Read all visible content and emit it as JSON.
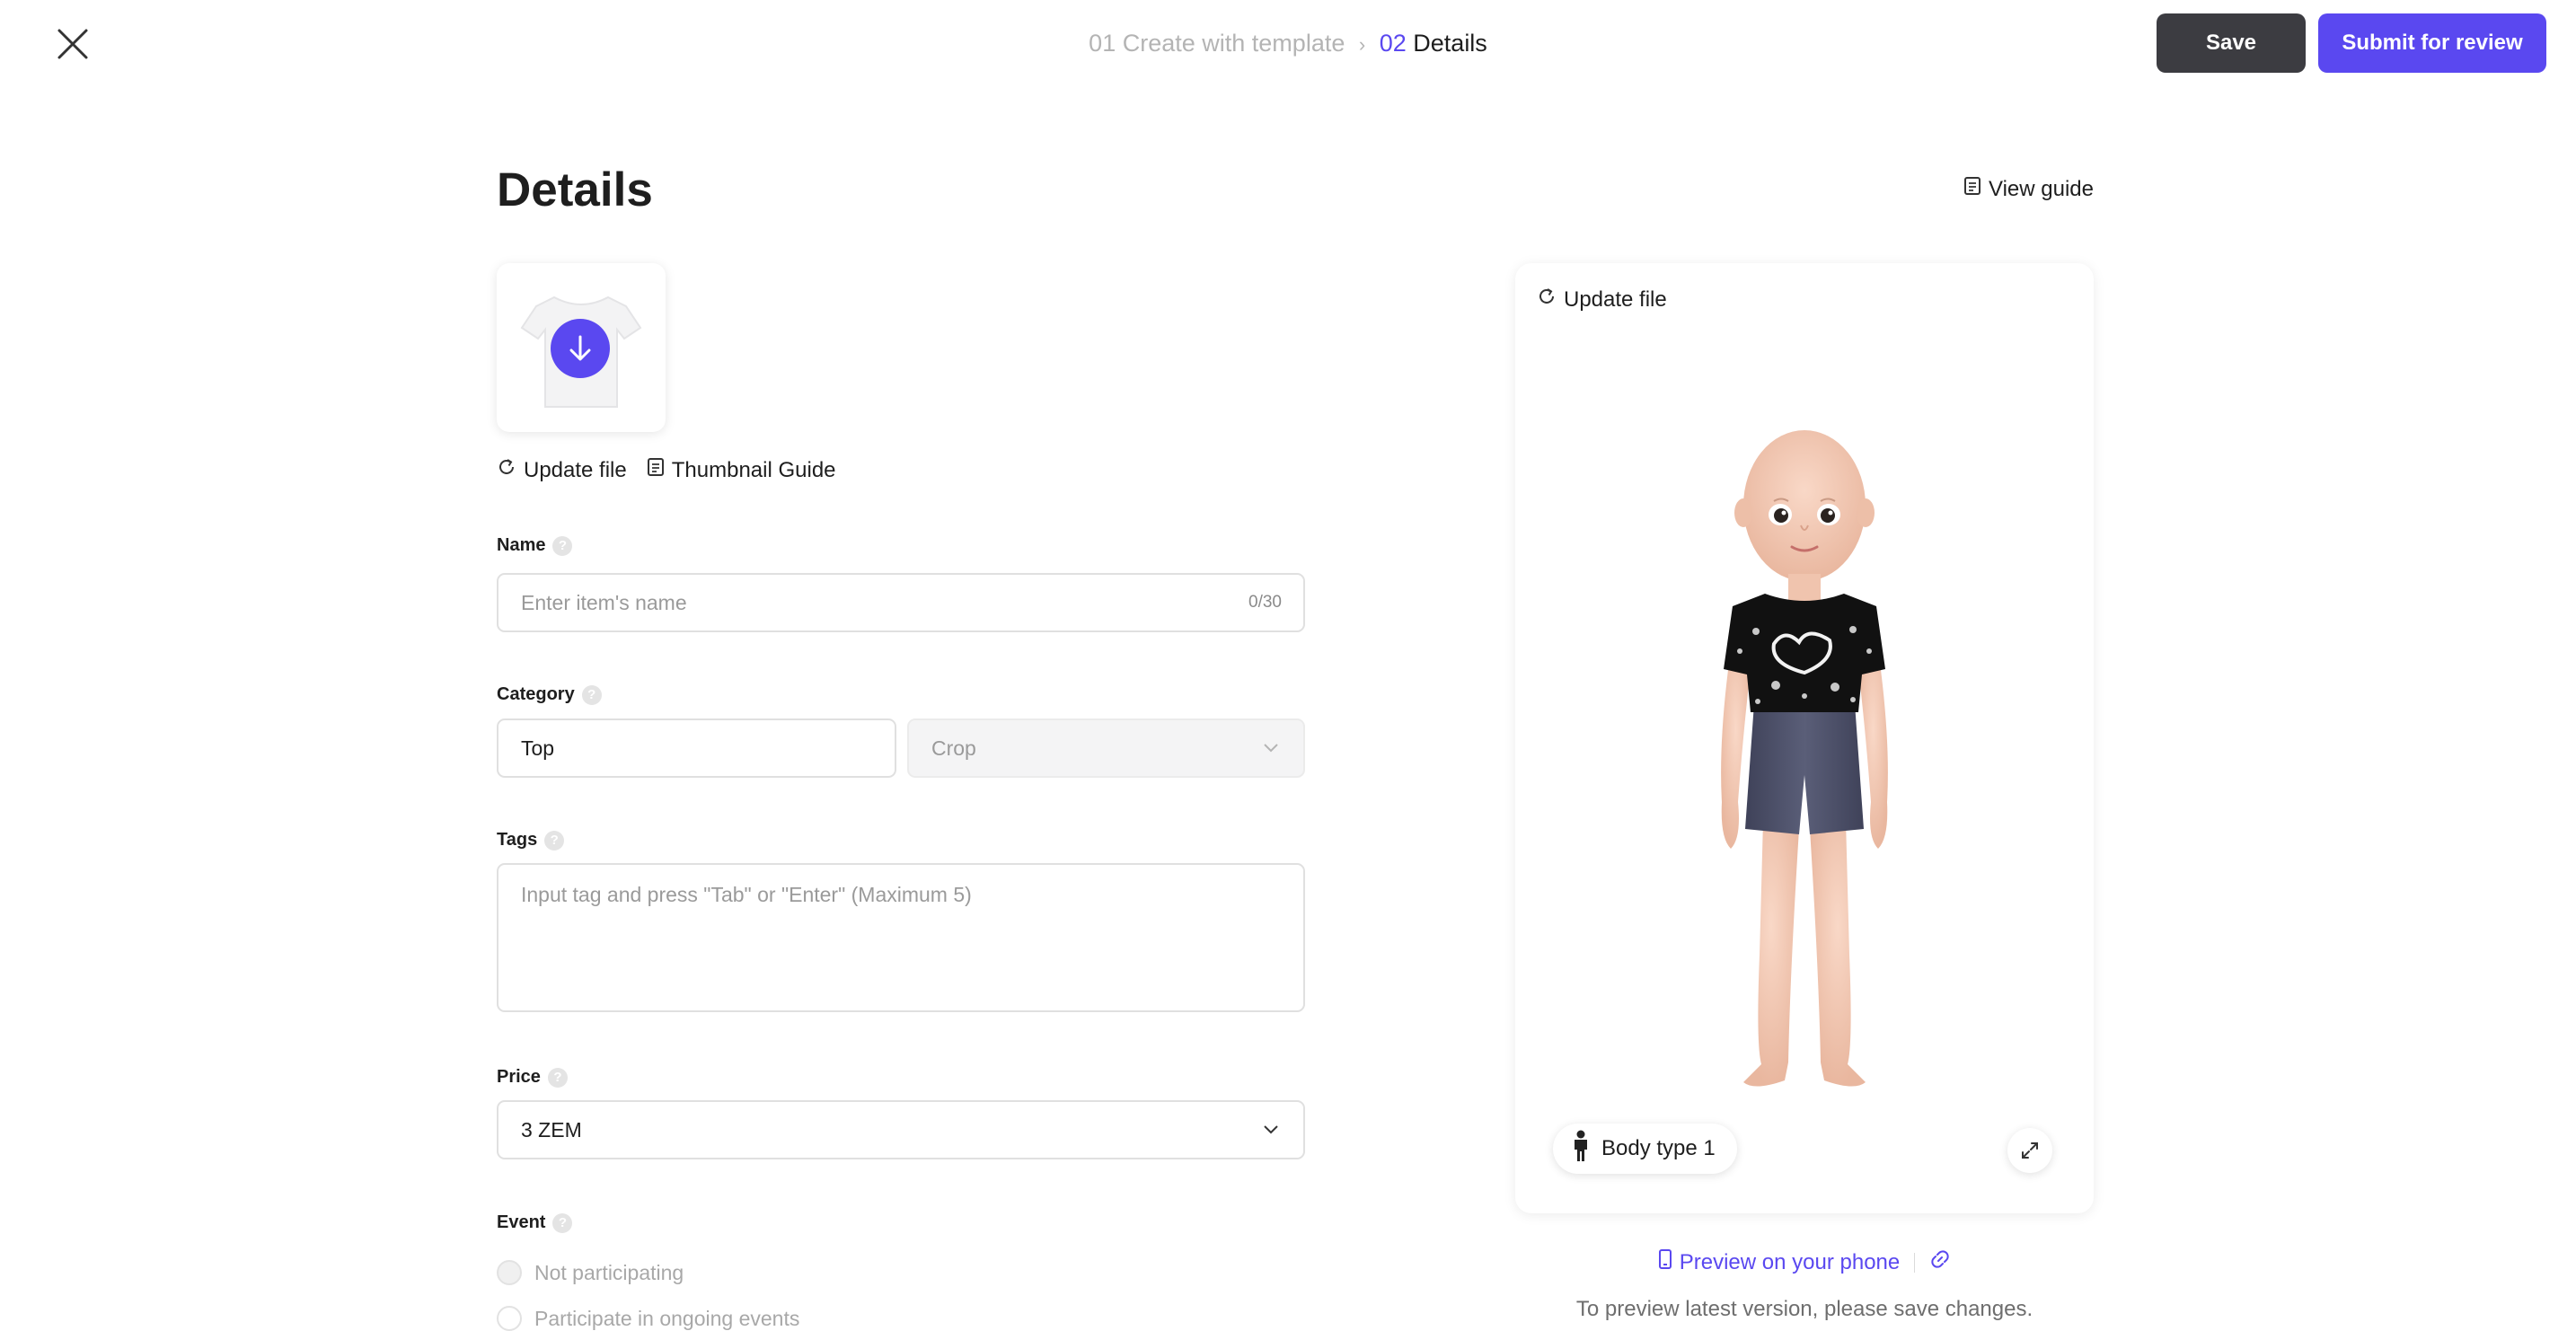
{
  "header": {
    "step1_num": "01",
    "step1_label": "Create with template",
    "step_separator": "›",
    "step2_num": "02",
    "step2_label": "Details",
    "save_label": "Save",
    "submit_label": "Submit for review"
  },
  "page": {
    "title": "Details",
    "view_guide": "View guide"
  },
  "thumbnail": {
    "update_file": "Update file",
    "thumbnail_guide": "Thumbnail Guide"
  },
  "form": {
    "name": {
      "label": "Name",
      "placeholder": "Enter item's name",
      "counter": "0/30"
    },
    "category": {
      "label": "Category",
      "value": "Top",
      "sub_value": "Crop"
    },
    "tags": {
      "label": "Tags",
      "placeholder": "Input tag and press \"Tab\" or \"Enter\" (Maximum 5)"
    },
    "price": {
      "label": "Price",
      "value": "3 ZEM"
    },
    "event": {
      "label": "Event",
      "options": [
        "Not participating",
        "Participate in ongoing events"
      ]
    }
  },
  "preview": {
    "update_file": "Update file",
    "body_type": "Body type 1",
    "preview_phone": "Preview on your phone",
    "note": "To preview latest version, please save changes."
  },
  "colors": {
    "accent": "#5a48f0",
    "save_button": "#3c3c41",
    "shorts": "#4e5168",
    "shirt": "#111111"
  }
}
